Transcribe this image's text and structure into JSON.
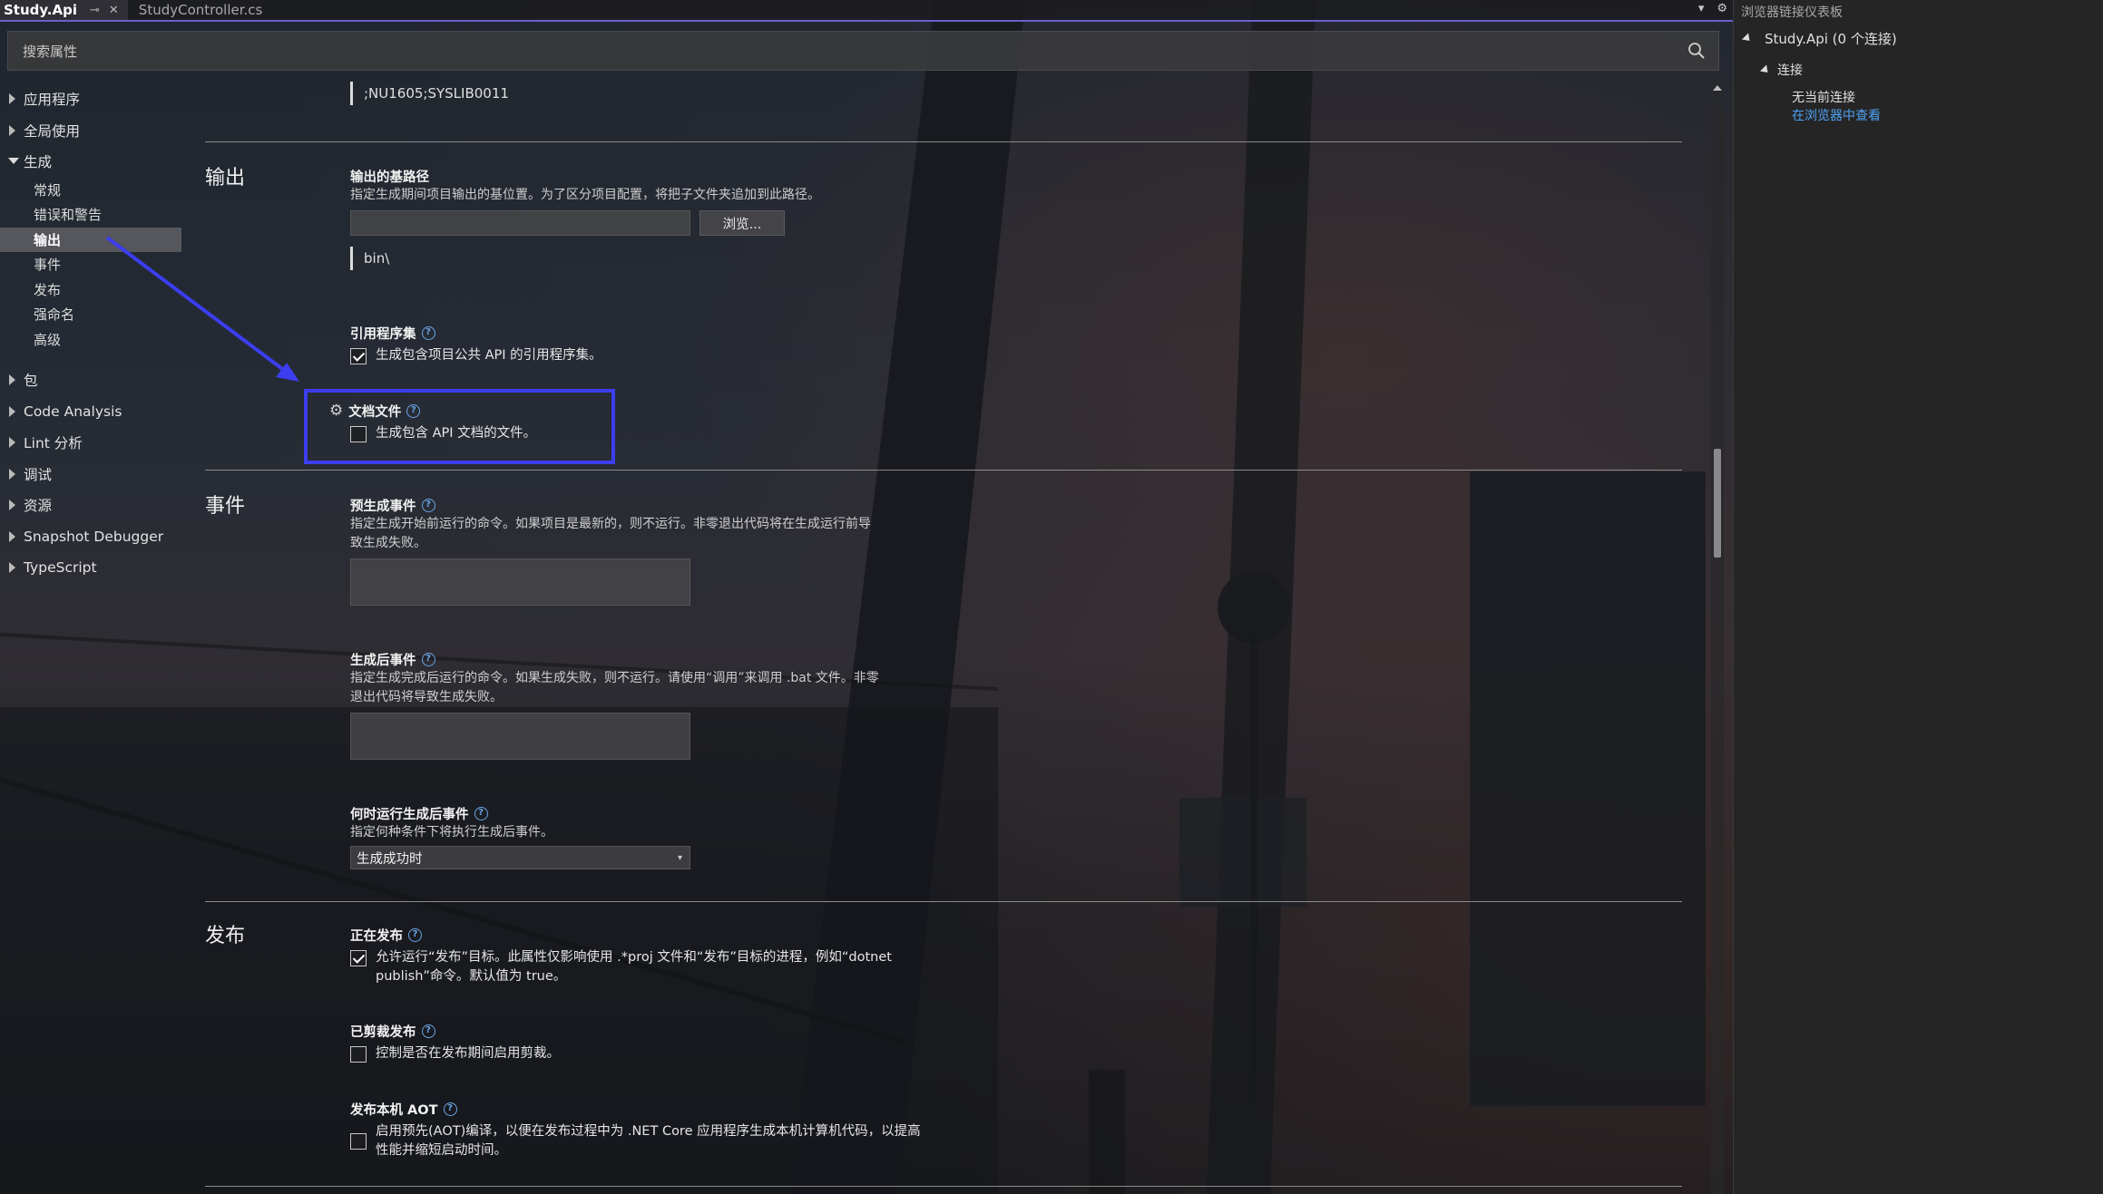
{
  "tabs": [
    {
      "label": "Study.Api",
      "active": true
    },
    {
      "label": "StudyController.cs",
      "active": false
    }
  ],
  "search": {
    "placeholder": "搜索属性"
  },
  "nav": {
    "items_top": [
      {
        "label": "应用程序",
        "expanded": false
      },
      {
        "label": "全局使用",
        "expanded": false
      },
      {
        "label": "生成",
        "expanded": true
      }
    ],
    "build_children": [
      "常规",
      "错误和警告",
      "输出",
      "事件",
      "发布",
      "强命名",
      "高级"
    ],
    "selected_child": "输出",
    "items_bottom": [
      {
        "label": "包"
      },
      {
        "label": "Code Analysis"
      },
      {
        "label": "Lint 分析"
      },
      {
        "label": "调试"
      },
      {
        "label": "资源"
      },
      {
        "label": "Snapshot Debugger"
      },
      {
        "label": "TypeScript"
      }
    ]
  },
  "content": {
    "top_value": ";NU1605;SYSLIB0011",
    "output": {
      "title": "输出",
      "base_path": {
        "title": "输出的基路径",
        "desc": "指定生成期间项目输出的基位置。为了区分项目配置，将把子文件夹追加到此路径。",
        "browse": "浏览...",
        "value": "bin\\"
      },
      "ref_assembly": {
        "title": "引用程序集",
        "checkbox": "生成包含项目公共 API 的引用程序集。",
        "checked": true
      },
      "doc_file": {
        "title": "文档文件",
        "checkbox": "生成包含 API 文档的文件。",
        "checked": false
      }
    },
    "events": {
      "title": "事件",
      "pre_build": {
        "title": "预生成事件",
        "desc1": "指定生成开始前运行的命令。如果项目是最新的，则不运行。非零退出代码将在生成运行前导",
        "desc2": "致生成失败。"
      },
      "post_build": {
        "title": "生成后事件",
        "desc1": "指定生成完成后运行的命令。如果生成失败，则不运行。请使用“调用”来调用 .bat 文件。非零",
        "desc2": "退出代码将导致生成失败。"
      },
      "when_run": {
        "title": "何时运行生成后事件",
        "desc": "指定何种条件下将执行生成后事件。",
        "value": "生成成功时"
      }
    },
    "publish": {
      "title": "发布",
      "publishing": {
        "title": "正在发布",
        "line1": "允许运行“发布”目标。此属性仅影响使用 .*proj 文件和“发布”目标的进程，例如“dotnet",
        "line2": "publish”命令。默认值为 true。",
        "checked": true
      },
      "trimmed": {
        "title": "已剪裁发布",
        "checkbox": "控制是否在发布期间启用剪裁。",
        "checked": false
      },
      "aot": {
        "title": "发布本机 AOT",
        "line1": "启用预先(AOT)编译，以便在发布过程中为 .NET Core 应用程序生成本机计算机代码，以提高",
        "line2": "性能并缩短启动时间。",
        "checked": false
      }
    }
  },
  "right_panel": {
    "title": "浏览器链接仪表板",
    "project": "Study.Api (0 个连接)",
    "group": "连接",
    "no_connection": "无当前连接",
    "view_link": "在浏览器中查看"
  },
  "colors": {
    "accent": "#6b5fd0",
    "highlight": "#3d3df0",
    "link": "#4ea1f3",
    "help": "#6aa6e8"
  }
}
